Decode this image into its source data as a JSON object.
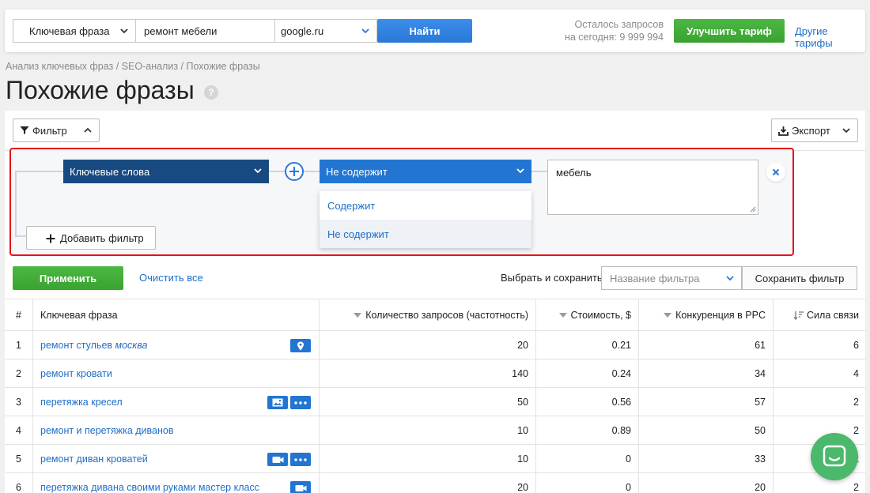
{
  "search": {
    "type_selected": "Ключевая фраза",
    "phrase_value": "ремонт мебели",
    "engine_selected": "google.ru",
    "find_label": "Найти",
    "remaining_line1": "Осталось запросов",
    "remaining_line2": "на сегодня: 9 999 994",
    "upgrade_label": "Улучшить тариф",
    "other_plans_label": "Другие тарифы"
  },
  "breadcrumb": "Анализ ключевых фраз / SEO-анализ / Похожие фразы",
  "page_title": "Похожие фразы",
  "help_icon": "?",
  "toolbar": {
    "filter_label": "Фильтр",
    "export_label": "Экспорт"
  },
  "filter": {
    "field_selected": "Ключевые слова",
    "condition_selected": "Не содержит",
    "condition_options": [
      "Содержит",
      "Не содержит"
    ],
    "value": "мебель",
    "add_filter_label": "Добавить фильтр"
  },
  "actions": {
    "apply_label": "Применить",
    "clear_label": "Очистить все",
    "select_save_label": "Выбрать и сохранить",
    "filter_name_placeholder": "Название фильтра",
    "save_filter_label": "Сохранить фильтр"
  },
  "table": {
    "headers": {
      "num": "#",
      "phrase": "Ключевая фраза",
      "freq": "Количество запросов (частотность)",
      "cost": "Стоимость, $",
      "comp": "Конкуренция в PPC",
      "rel": "Сила связи"
    },
    "rows": [
      {
        "num": "1",
        "phrase": "ремонт стульев",
        "phrase_geo": "москва",
        "freq": "20",
        "cost": "0.21",
        "comp": "61",
        "rel": "6"
      },
      {
        "num": "2",
        "phrase": "ремонт кровати",
        "phrase_geo": "",
        "freq": "140",
        "cost": "0.24",
        "comp": "34",
        "rel": "4"
      },
      {
        "num": "3",
        "phrase": "перетяжка кресел",
        "phrase_geo": "",
        "freq": "50",
        "cost": "0.56",
        "comp": "57",
        "rel": "2"
      },
      {
        "num": "4",
        "phrase": "ремонт и перетяжка диванов",
        "phrase_geo": "",
        "freq": "10",
        "cost": "0.89",
        "comp": "50",
        "rel": "2"
      },
      {
        "num": "5",
        "phrase": "ремонт диван кроватей",
        "phrase_geo": "",
        "freq": "10",
        "cost": "0",
        "comp": "33",
        "rel": "2"
      },
      {
        "num": "6",
        "phrase": "перетяжка дивана своими руками мастер класс",
        "phrase_geo": "",
        "freq": "20",
        "cost": "0",
        "comp": "20",
        "rel": "2"
      }
    ]
  },
  "colors": {
    "accent_blue": "#2276d2",
    "dark_blue": "#174a80",
    "green": "#3aa231",
    "highlight_red": "#e5121b",
    "chat_green": "#4bb86b"
  }
}
